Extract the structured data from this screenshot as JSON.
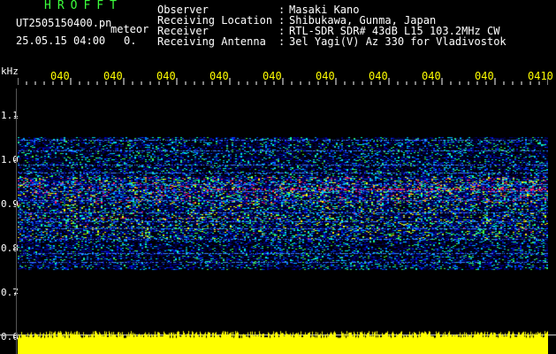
{
  "header": {
    "brand": "HROFFT",
    "filename": "UT2505150400.pn",
    "tag": "meteor",
    "datetime": "25.05.15 04:00",
    "extra": "0.",
    "info": [
      {
        "label": "Observer",
        "value": "Masaki Kano"
      },
      {
        "label": "Receiving Location",
        "value": "Shibukawa, Gunma, Japan"
      },
      {
        "label": "Receiver",
        "value": "RTL-SDR SDR# 43dB L15 103.2MHz CW"
      },
      {
        "label": "Receiving Antenna",
        "value": "3el Yagi(V) Az 330 for Vladivostok"
      }
    ]
  },
  "axes": {
    "y_unit": "kHz",
    "y_labels": [
      "1.1",
      "1.0",
      "0.9",
      "0.8",
      "0.7",
      "0.6"
    ],
    "x_labels": [
      "040",
      "040",
      "040",
      "040",
      "040",
      "040",
      "040",
      "040",
      "040",
      "0410"
    ],
    "colors": {
      "tick": "#ffff00",
      "axis_text": "#ffffff",
      "brand": "#3cff3c",
      "power": "#ffff00"
    }
  }
}
